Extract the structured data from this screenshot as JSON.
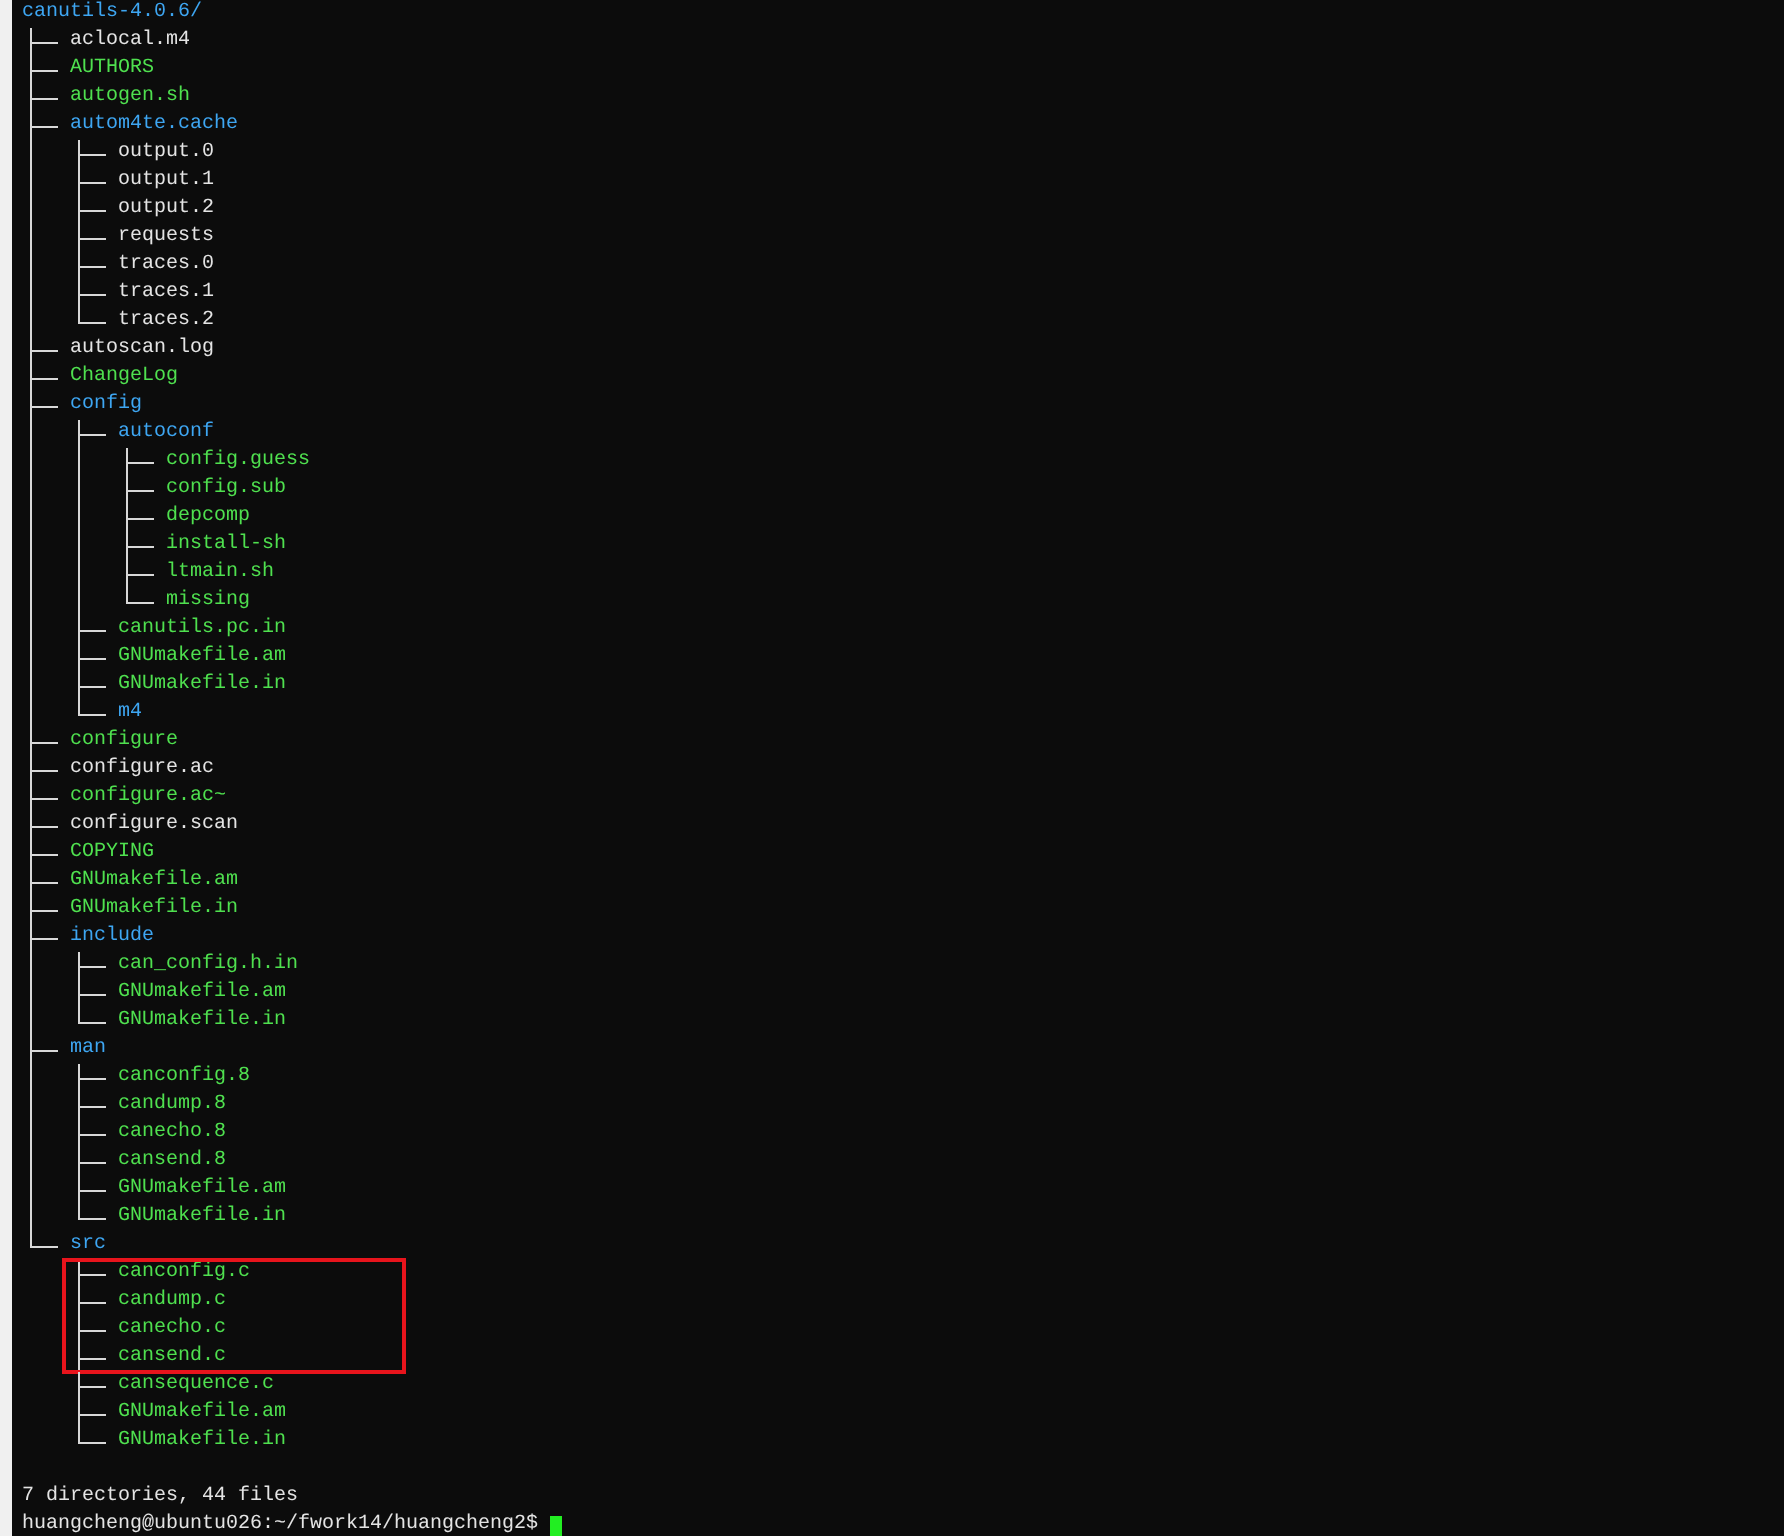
{
  "tree": {
    "name": "canutils-4.0.6/",
    "kind": "dir",
    "children": [
      {
        "name": "aclocal.m4",
        "kind": "file"
      },
      {
        "name": "AUTHORS",
        "kind": "exec"
      },
      {
        "name": "autogen.sh",
        "kind": "exec"
      },
      {
        "name": "autom4te.cache",
        "kind": "dir",
        "children": [
          {
            "name": "output.0",
            "kind": "file"
          },
          {
            "name": "output.1",
            "kind": "file"
          },
          {
            "name": "output.2",
            "kind": "file"
          },
          {
            "name": "requests",
            "kind": "file"
          },
          {
            "name": "traces.0",
            "kind": "file"
          },
          {
            "name": "traces.1",
            "kind": "file"
          },
          {
            "name": "traces.2",
            "kind": "file"
          }
        ]
      },
      {
        "name": "autoscan.log",
        "kind": "file"
      },
      {
        "name": "ChangeLog",
        "kind": "exec"
      },
      {
        "name": "config",
        "kind": "dir",
        "children": [
          {
            "name": "autoconf",
            "kind": "dir",
            "children": [
              {
                "name": "config.guess",
                "kind": "exec"
              },
              {
                "name": "config.sub",
                "kind": "exec"
              },
              {
                "name": "depcomp",
                "kind": "exec"
              },
              {
                "name": "install-sh",
                "kind": "exec"
              },
              {
                "name": "ltmain.sh",
                "kind": "exec"
              },
              {
                "name": "missing",
                "kind": "exec"
              }
            ]
          },
          {
            "name": "canutils.pc.in",
            "kind": "exec"
          },
          {
            "name": "GNUmakefile.am",
            "kind": "exec"
          },
          {
            "name": "GNUmakefile.in",
            "kind": "exec"
          },
          {
            "name": "m4",
            "kind": "dir"
          }
        ]
      },
      {
        "name": "configure",
        "kind": "exec"
      },
      {
        "name": "configure.ac",
        "kind": "file"
      },
      {
        "name": "configure.ac~",
        "kind": "exec"
      },
      {
        "name": "configure.scan",
        "kind": "file"
      },
      {
        "name": "COPYING",
        "kind": "exec"
      },
      {
        "name": "GNUmakefile.am",
        "kind": "exec"
      },
      {
        "name": "GNUmakefile.in",
        "kind": "exec"
      },
      {
        "name": "include",
        "kind": "dir",
        "children": [
          {
            "name": "can_config.h.in",
            "kind": "exec"
          },
          {
            "name": "GNUmakefile.am",
            "kind": "exec"
          },
          {
            "name": "GNUmakefile.in",
            "kind": "exec"
          }
        ]
      },
      {
        "name": "man",
        "kind": "dir",
        "children": [
          {
            "name": "canconfig.8",
            "kind": "exec"
          },
          {
            "name": "candump.8",
            "kind": "exec"
          },
          {
            "name": "canecho.8",
            "kind": "exec"
          },
          {
            "name": "cansend.8",
            "kind": "exec"
          },
          {
            "name": "GNUmakefile.am",
            "kind": "exec"
          },
          {
            "name": "GNUmakefile.in",
            "kind": "exec"
          }
        ]
      },
      {
        "name": "src",
        "kind": "dir",
        "children": [
          {
            "name": "canconfig.c",
            "kind": "exec",
            "highlighted": true
          },
          {
            "name": "candump.c",
            "kind": "exec",
            "highlighted": true
          },
          {
            "name": "canecho.c",
            "kind": "exec",
            "highlighted": true
          },
          {
            "name": "cansend.c",
            "kind": "exec",
            "highlighted": true
          },
          {
            "name": "cansequence.c",
            "kind": "exec",
            "highlighted": false
          },
          {
            "name": "GNUmakefile.am",
            "kind": "exec",
            "highlighted": false
          },
          {
            "name": "GNUmakefile.in",
            "kind": "exec",
            "highlighted": false
          }
        ]
      }
    ]
  },
  "summary": "7 directories, 44 files",
  "prompt": "huangcheng@ubuntu026:~/fwork14/huangcheng2$"
}
